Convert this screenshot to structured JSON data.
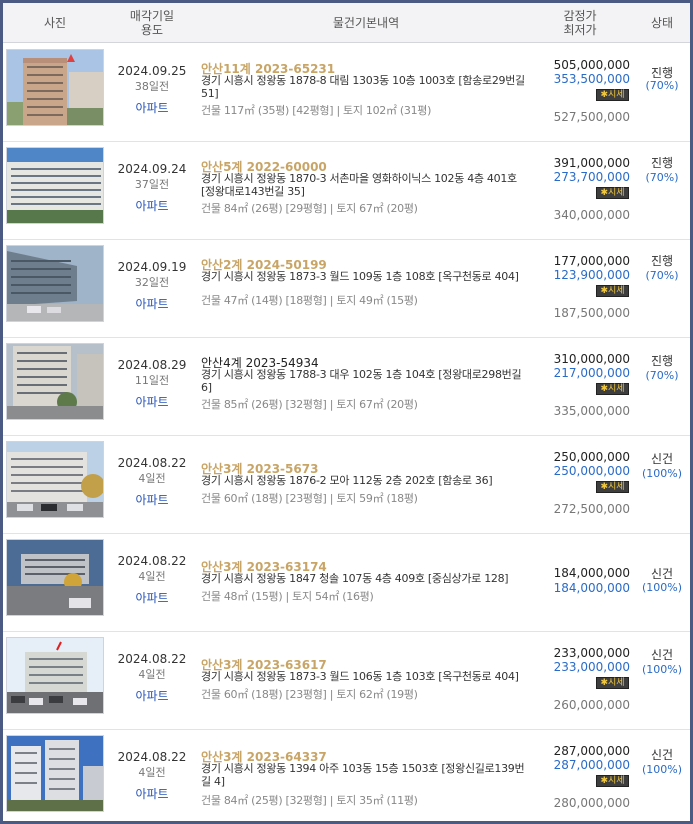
{
  "header": {
    "photo": "사진",
    "date_line1": "매각기일",
    "date_line2": "용도",
    "details": "물건기본내역",
    "price_line1": "감정가",
    "price_line2": "최저가",
    "status": "상태"
  },
  "rows": [
    {
      "date": "2024.09.25",
      "days": "38일전",
      "type": "아파트",
      "case_no": "안산11계 2023-65231",
      "address": "경기 시흥시 정왕동 1878-8 대림 1303동 10층 1003호 [함송로29번길 51]",
      "area": "건물 117㎡ (35평) [42평형]  |  토지 102㎡ (31평)",
      "appraised": "505,000,000",
      "minimum": "353,500,000",
      "market_badge": "시세",
      "market_price": "527,500,000",
      "status": "진행",
      "percent": "(70%)"
    },
    {
      "date": "2024.09.24",
      "days": "37일전",
      "type": "아파트",
      "case_no": "안산5계 2022-60000",
      "address": "경기 시흥시 정왕동 1870-3 서촌마을 영화하이닉스 102동 4층 401호 [정왕대로143번길 35]",
      "area": "건물 84㎡ (26평) [29평형]  |  토지 67㎡ (20평)",
      "appraised": "391,000,000",
      "minimum": "273,700,000",
      "market_badge": "시세",
      "market_price": "340,000,000",
      "status": "진행",
      "percent": "(70%)"
    },
    {
      "date": "2024.09.19",
      "days": "32일전",
      "type": "아파트",
      "case_no": "안산2계 2024-50199",
      "address": "경기 시흥시 정왕동 1873-3 월드 109동 1층 108호 [옥구천동로 404]",
      "area": "건물 47㎡ (14평) [18평형]  |  토지 49㎡ (15평)",
      "appraised": "177,000,000",
      "minimum": "123,900,000",
      "market_badge": "시세",
      "market_price": "187,500,000",
      "status": "진행",
      "percent": "(70%)"
    },
    {
      "date": "2024.08.29",
      "days": "11일전",
      "type": "아파트",
      "case_no": "안산4계 2023-54934",
      "address": "경기 시흥시 정왕동 1788-3 대우 102동 1층 104호 [정왕대로298번길 6]",
      "area": "건물 85㎡ (26평) [32평형]  |  토지 67㎡ (20평)",
      "appraised": "310,000,000",
      "minimum": "217,000,000",
      "market_badge": "시세",
      "market_price": "335,000,000",
      "status": "진행",
      "percent": "(70%)"
    },
    {
      "date": "2024.08.22",
      "days": "4일전",
      "type": "아파트",
      "case_no": "안산3계 2023-5673",
      "address": "경기 시흥시 정왕동 1876-2 모아 112동 2층 202호 [함송로 36]",
      "area": "건물 60㎡ (18평) [23평형]  |  토지 59㎡ (18평)",
      "appraised": "250,000,000",
      "minimum": "250,000,000",
      "market_badge": "시세",
      "market_price": "272,500,000",
      "status": "신건",
      "percent": "(100%)"
    },
    {
      "date": "2024.08.22",
      "days": "4일전",
      "type": "아파트",
      "case_no": "안산3계 2023-63174",
      "address": "경기 시흥시 정왕동 1847 청솔 107동 4층 409호 [중심상가로 128]",
      "area": "건물 48㎡ (15평)  |  토지 54㎡ (16평)",
      "appraised": "184,000,000",
      "minimum": "184,000,000",
      "market_badge": "",
      "market_price": "",
      "status": "신건",
      "percent": "(100%)"
    },
    {
      "date": "2024.08.22",
      "days": "4일전",
      "type": "아파트",
      "case_no": "안산3계 2023-63617",
      "address": "경기 시흥시 정왕동 1873-3 월드 106동 1층 103호 [옥구천동로 404]",
      "area": "건물 60㎡ (18평) [23평형]  |  토지 62㎡ (19평)",
      "appraised": "233,000,000",
      "minimum": "233,000,000",
      "market_badge": "시세",
      "market_price": "260,000,000",
      "status": "신건",
      "percent": "(100%)"
    },
    {
      "date": "2024.08.22",
      "days": "4일전",
      "type": "아파트",
      "case_no": "안산3계 2023-64337",
      "address": "경기 시흥시 정왕동 1394 아주 103동 15층 1503호 [정왕신길로139번길 4]",
      "area": "건물 84㎡ (25평) [32평형]  |  토지 35㎡ (11평)",
      "appraised": "287,000,000",
      "minimum": "287,000,000",
      "market_badge": "시세",
      "market_price": "280,000,000",
      "status": "신건",
      "percent": "(100%)"
    }
  ]
}
